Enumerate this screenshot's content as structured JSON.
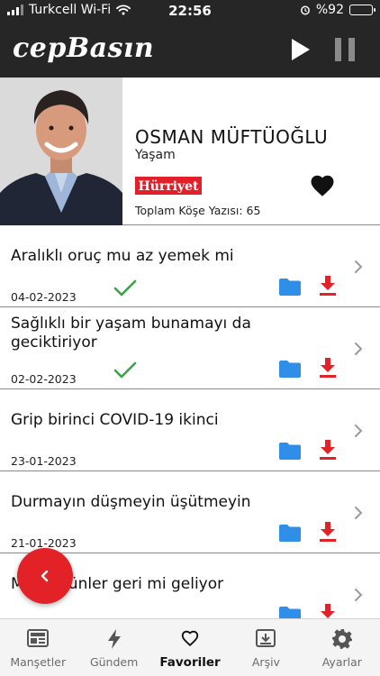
{
  "status_bar": {
    "carrier": "Turkcell Wi-Fi",
    "time": "22:56",
    "battery": "%92",
    "battery_level": 0.92
  },
  "header": {
    "logo": "cepBasın"
  },
  "author": {
    "name": "OSMAN MÜFTÜOĞLU",
    "category": "Yaşam",
    "newspaper": "Hürriyet",
    "total_label": "Toplam Köşe Yazısı: 65"
  },
  "articles": [
    {
      "title": "Aralıklı oruç mu az yemek mi",
      "date": "04-02-2023",
      "read": true
    },
    {
      "title": "Sağlıklı bir yaşam bunamayı da geciktiriyor",
      "date": "02-02-2023",
      "read": true
    },
    {
      "title": "Grip birinci COVID-19 ikinci",
      "date": "23-01-2023",
      "read": false
    },
    {
      "title": "Durmayın düşmeyin üşütmeyin",
      "date": "21-01-2023",
      "read": false
    },
    {
      "title": "Mutlu günler geri mi geliyor",
      "date": "",
      "read": false
    }
  ],
  "tabs": [
    {
      "label": "Manşetler",
      "icon": "newspaper-icon"
    },
    {
      "label": "Gündem",
      "icon": "bolt-icon"
    },
    {
      "label": "Favoriler",
      "icon": "heart-icon",
      "active": true
    },
    {
      "label": "Arşiv",
      "icon": "archive-icon"
    },
    {
      "label": "Ayarlar",
      "icon": "gear-icon"
    }
  ],
  "colors": {
    "bar": "#262626",
    "accent_red": "#e32228",
    "folder_blue": "#2f8fe8",
    "check_green": "#3aa34a"
  }
}
